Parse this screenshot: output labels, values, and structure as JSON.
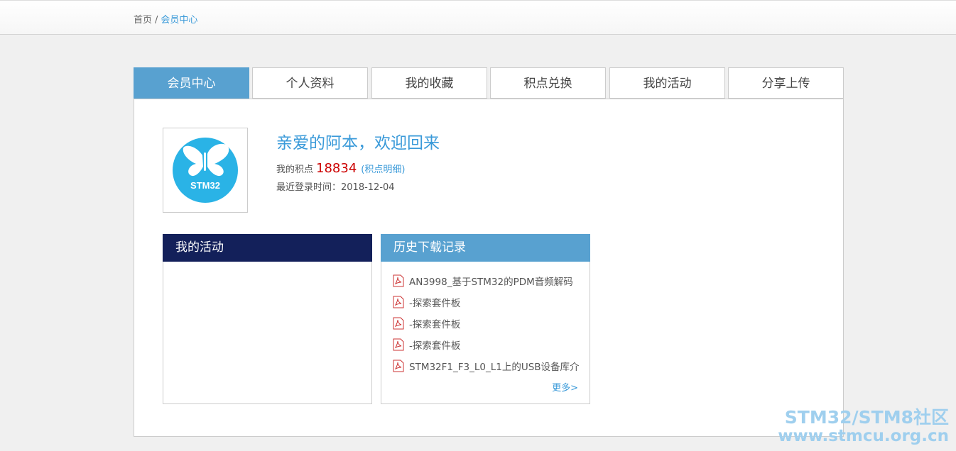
{
  "breadcrumb": {
    "home": "首页",
    "separator": "/",
    "current": "会员中心"
  },
  "tabs": [
    {
      "label": "会员中心",
      "active": true
    },
    {
      "label": "个人资料",
      "active": false
    },
    {
      "label": "我的收藏",
      "active": false
    },
    {
      "label": "积点兑换",
      "active": false
    },
    {
      "label": "我的活动",
      "active": false
    },
    {
      "label": "分享上传",
      "active": false
    }
  ],
  "profile": {
    "welcome": "亲爱的阿本，欢迎回来",
    "points_label": "我的积点",
    "points_value": "18834",
    "points_detail": "(积点明细)",
    "last_login": "最近登录时间：2018-12-04",
    "avatar_text": "STM32"
  },
  "activity_box": {
    "title": "我的活动"
  },
  "history_box": {
    "title": "历史下载记录",
    "items": [
      "AN3998_基于STM32的PDM音频解码",
      "-探索套件板",
      "-探索套件板",
      "-探索套件板",
      "STM32F1_F3_L0_L1上的USB设备库介"
    ],
    "more": "更多>"
  },
  "watermark": {
    "line1": "STM32/STM8社区",
    "line2": "www.stmcu.org.cn"
  },
  "colors": {
    "accent": "#58a1d0",
    "dark_header": "#13205a",
    "link": "#3a9ad9",
    "points": "#cc0000"
  }
}
